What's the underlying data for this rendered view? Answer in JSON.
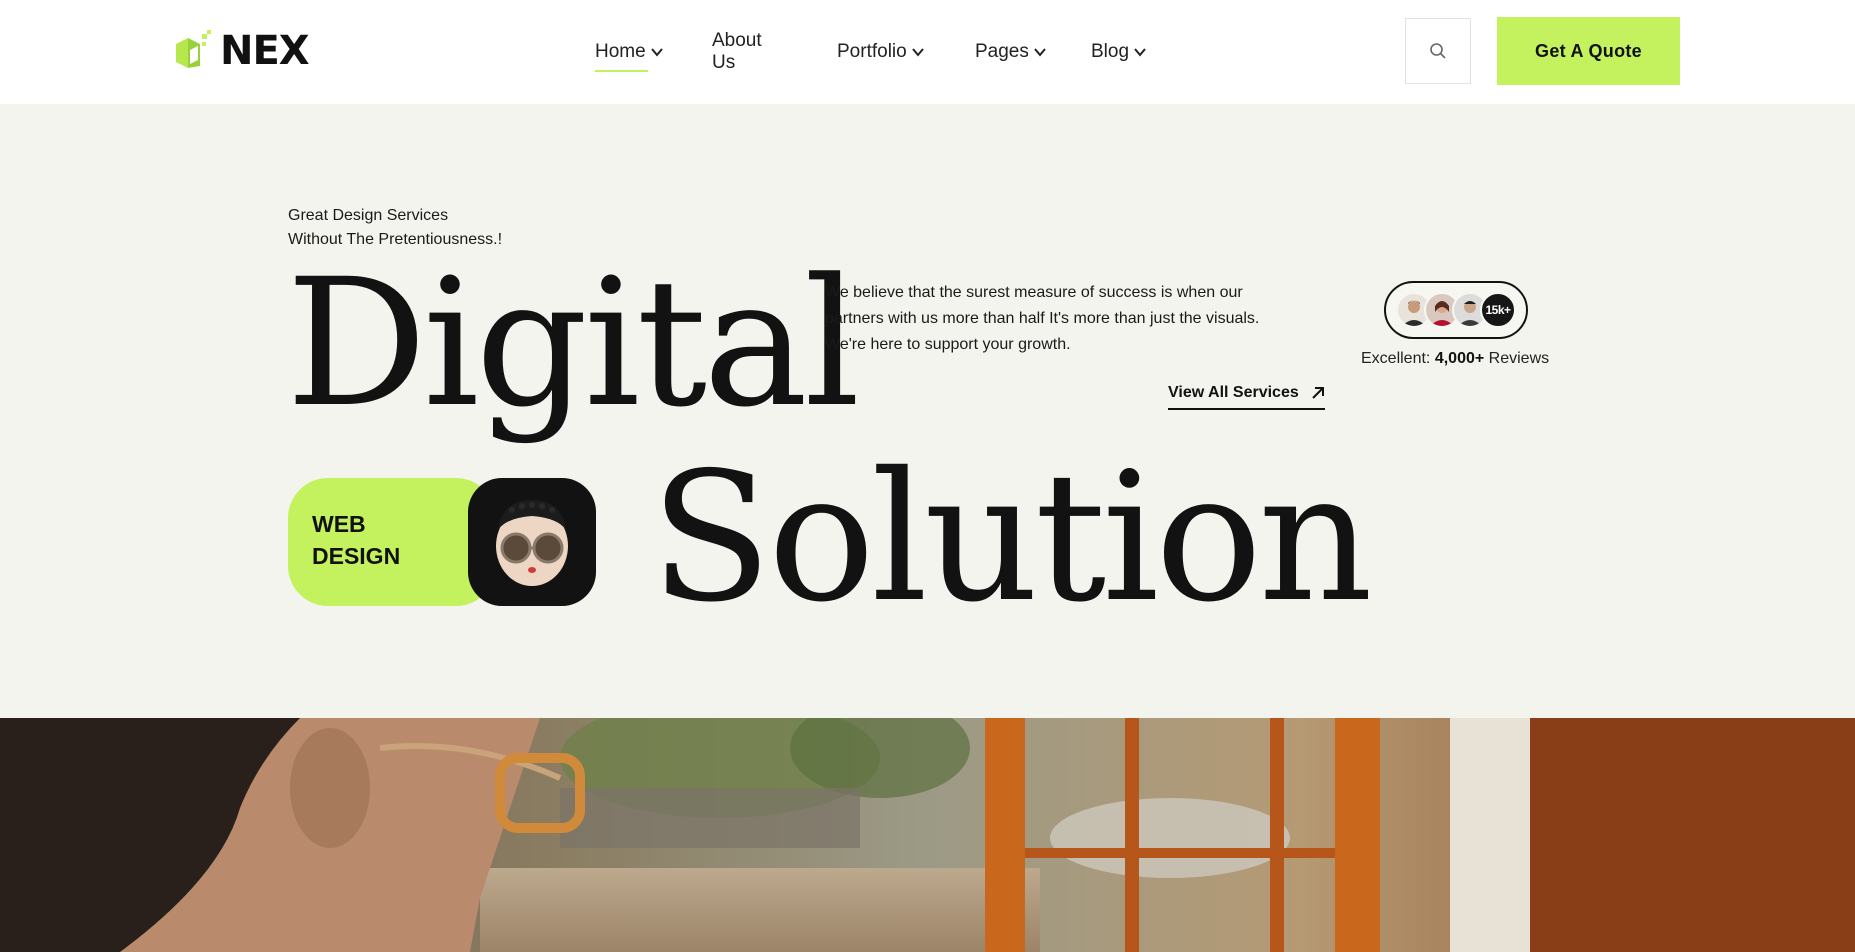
{
  "header": {
    "logo_text": "NEX",
    "nav": [
      {
        "label": "Home",
        "has_dropdown": true,
        "active": true
      },
      {
        "label": "About Us",
        "has_dropdown": false
      },
      {
        "label": "Portfolio",
        "has_dropdown": true
      },
      {
        "label": "Pages",
        "has_dropdown": true
      },
      {
        "label": "Blog",
        "has_dropdown": true
      }
    ],
    "search_icon": "search-icon",
    "quote_button": "Get A Quote"
  },
  "hero": {
    "tagline_line1": "Great Design Services",
    "tagline_line2": "Without The Pretentiousness.!",
    "headline_1": "Digital",
    "headline_2": "Solution",
    "description": "We believe that the surest measure of success is when our partners with us more than half It's more than just the visuals. We're here to support your growth.",
    "view_all": "View All Services",
    "reviews_count_badge": "15k+",
    "reviews_prefix": "Excellent:",
    "reviews_number": "4,000+",
    "reviews_suffix": "Reviews",
    "badge_line1": "WEB",
    "badge_line2": "DESIGN"
  },
  "colors": {
    "accent": "#c3f25e",
    "dark": "#121212",
    "hero_bg": "#f3f4ee"
  }
}
